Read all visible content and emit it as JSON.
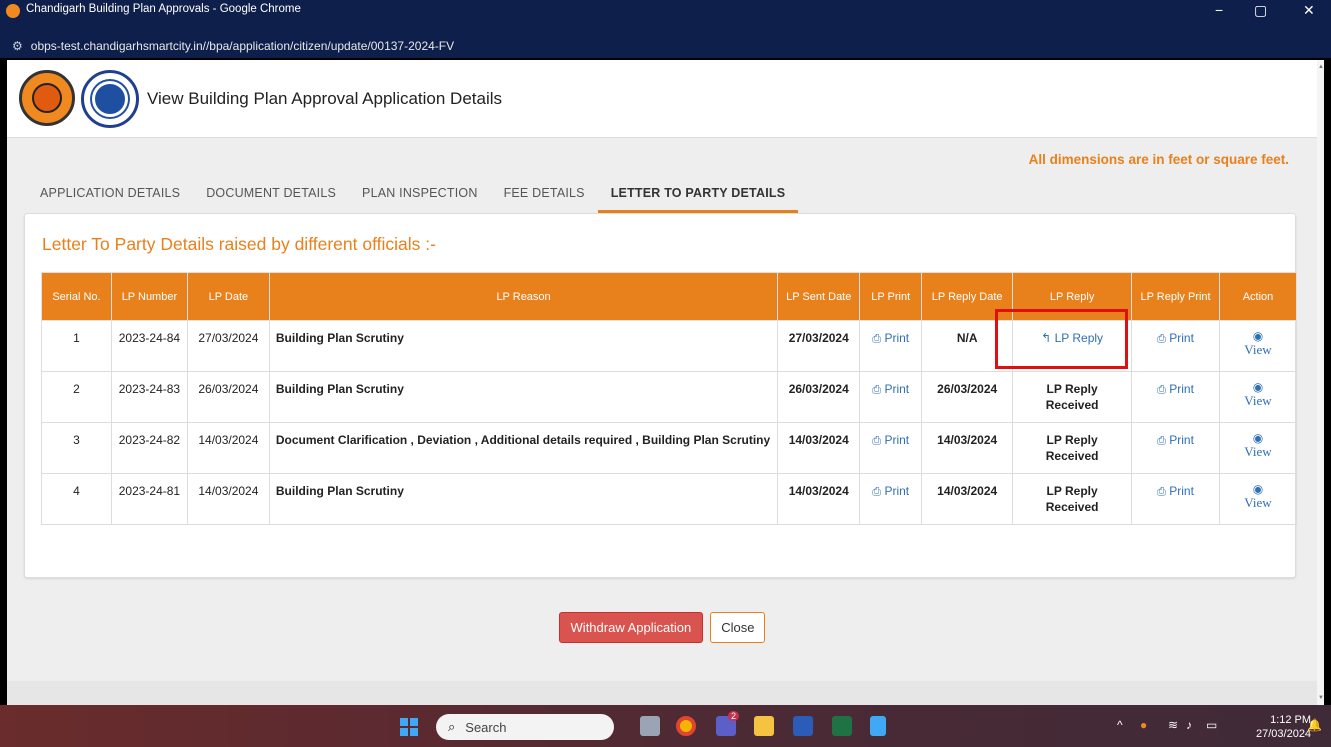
{
  "window": {
    "title": "Chandigarh Building Plan Approvals - Google Chrome",
    "minimize": "−",
    "restore": "▢",
    "close": "✕"
  },
  "address": {
    "url": "obps-test.chandigarhsmartcity.in//bpa/application/citizen/update/00137-2024-FV"
  },
  "header": {
    "title": "View Building Plan Approval Application Details"
  },
  "note": "All dimensions are in feet or square feet.",
  "tabs": [
    {
      "label": "APPLICATION DETAILS"
    },
    {
      "label": "DOCUMENT DETAILS"
    },
    {
      "label": "PLAN INSPECTION"
    },
    {
      "label": "FEE DETAILS"
    },
    {
      "label": "LETTER TO PARTY DETAILS"
    }
  ],
  "section": {
    "title": "Letter To Party Details raised by different officials :-"
  },
  "table": {
    "headers": {
      "serial": "Serial No.",
      "lp_number": "LP Number",
      "lp_date": "LP Date",
      "lp_reason": "LP Reason",
      "lp_sent_date": "LP Sent Date",
      "lp_print": "LP Print",
      "lp_reply_date": "LP Reply Date",
      "lp_reply": "LP Reply",
      "lp_reply_print": "LP Reply Print",
      "action": "Action"
    },
    "rows": [
      {
        "serial": "1",
        "lp_number": "2023-24-84",
        "lp_date": "27/03/2024",
        "reason": "Building Plan Scrutiny",
        "sent_date": "27/03/2024",
        "print": "Print",
        "reply_date": "N/A",
        "reply": "LP Reply",
        "reply_print": "Print",
        "action": "View"
      },
      {
        "serial": "2",
        "lp_number": "2023-24-83",
        "lp_date": "26/03/2024",
        "reason": "Building Plan Scrutiny",
        "sent_date": "26/03/2024",
        "print": "Print",
        "reply_date": "26/03/2024",
        "reply": "LP Reply Received",
        "reply_print": "Print",
        "action": "View"
      },
      {
        "serial": "3",
        "lp_number": "2023-24-82",
        "lp_date": "14/03/2024",
        "reason": "Document Clarification , Deviation , Additional details required , Building Plan Scrutiny",
        "sent_date": "14/03/2024",
        "print": "Print",
        "reply_date": "14/03/2024",
        "reply": "LP Reply Received",
        "reply_print": "Print",
        "action": "View"
      },
      {
        "serial": "4",
        "lp_number": "2023-24-81",
        "lp_date": "14/03/2024",
        "reason": "Building Plan Scrutiny",
        "sent_date": "14/03/2024",
        "print": "Print",
        "reply_date": "14/03/2024",
        "reply": "LP Reply Received",
        "reply_print": "Print",
        "action": "View"
      }
    ]
  },
  "buttons": {
    "withdraw": "Withdraw Application",
    "close": "Close"
  },
  "taskbar": {
    "search_placeholder": "Search",
    "teams_badge": "2",
    "time": "1:12 PM",
    "date": "27/03/2024"
  },
  "colors": {
    "accent": "#e8801c",
    "danger": "#d9534f",
    "link": "#2f6fb5",
    "highlight": "#e01010"
  }
}
